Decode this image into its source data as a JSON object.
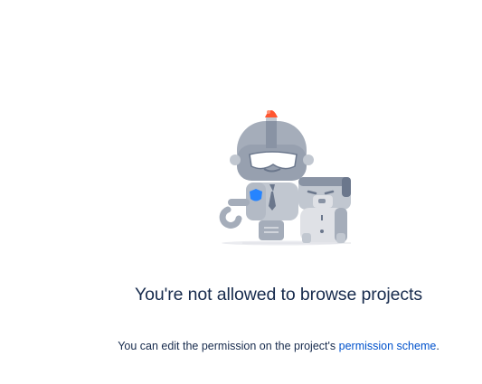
{
  "empty_state": {
    "illustration_icon": "robot-and-dog-icon",
    "title": "You're not allowed to browse projects",
    "message_prefix": "You can edit the permission on the project's ",
    "link_label": "permission scheme",
    "message_suffix": "."
  },
  "colors": {
    "text": "#172b4d",
    "link": "#0052cc",
    "siren": "#ff5630",
    "robot_body": "#97a0af",
    "shield": "#2684ff"
  }
}
